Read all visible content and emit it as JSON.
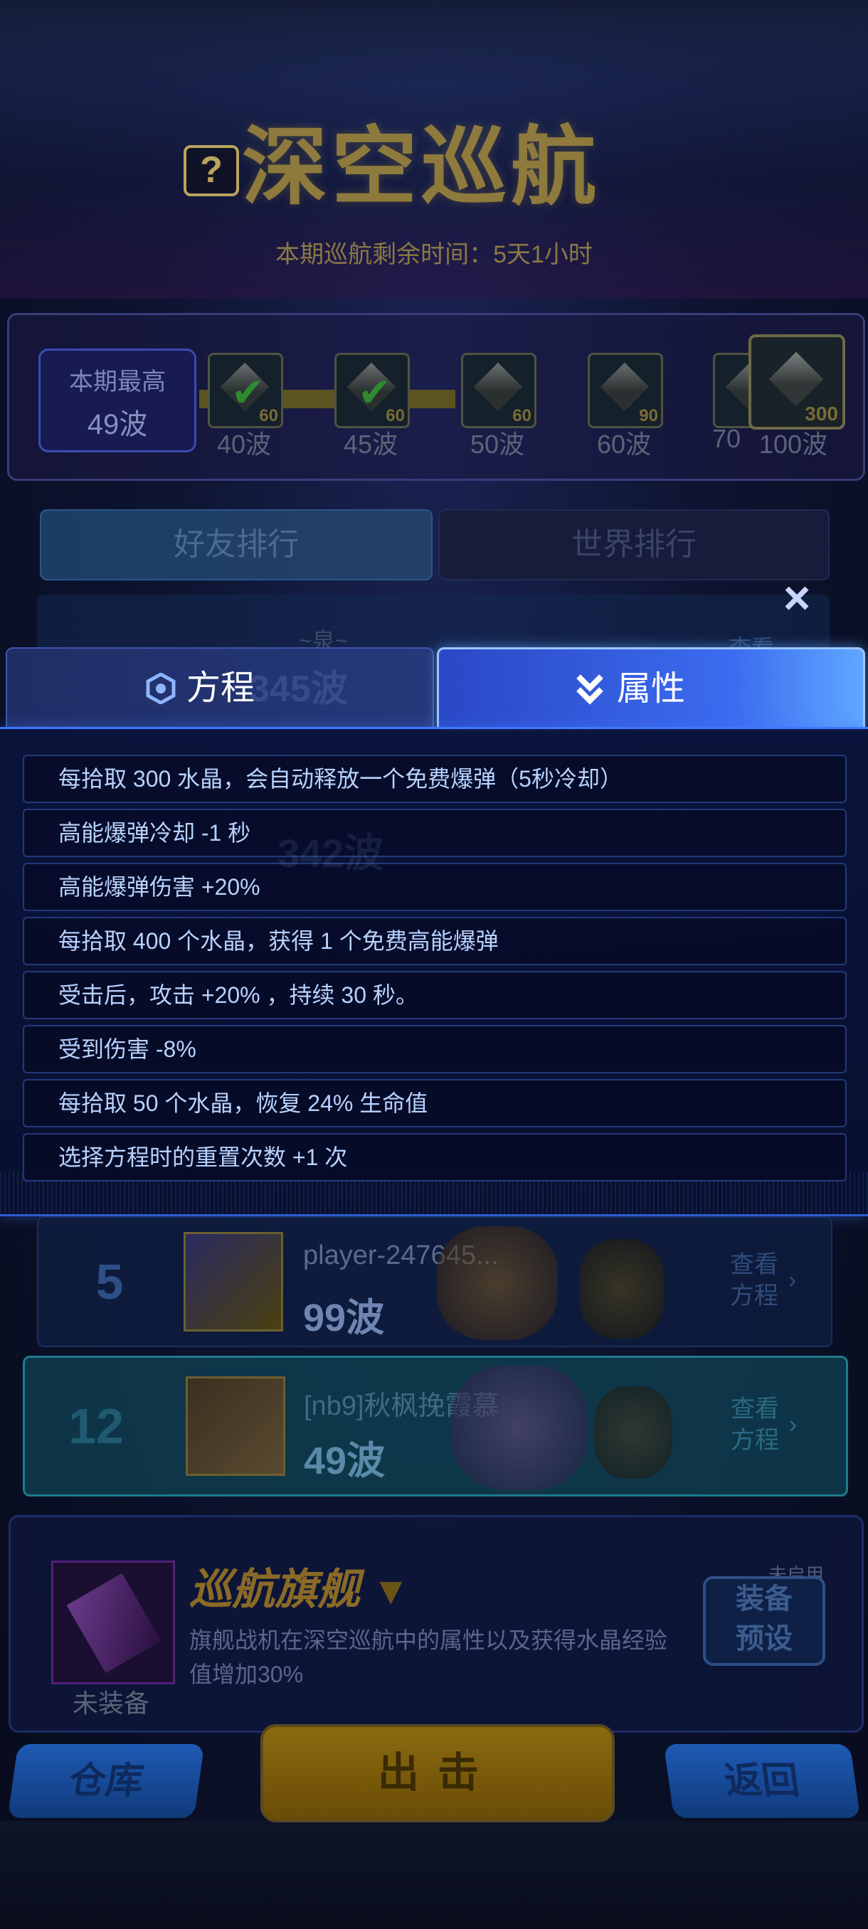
{
  "header": {
    "help_icon": "?",
    "title": "深空巡航",
    "remaining_time": "本期巡航剩余时间：5天1小时"
  },
  "progress": {
    "best_label": "本期最高",
    "best_value": "49波",
    "milestones": [
      {
        "label": "40波",
        "reward": "60",
        "claimed": true
      },
      {
        "label": "45波",
        "reward": "60",
        "claimed": true
      },
      {
        "label": "50波",
        "reward": "60",
        "claimed": false
      },
      {
        "label": "60波",
        "reward": "90",
        "claimed": false
      },
      {
        "label": "70",
        "reward": "",
        "claimed": false
      },
      {
        "label": "100波",
        "reward": "300",
        "claimed": false
      }
    ]
  },
  "tabs": {
    "friends": "好友排行",
    "world": "世界排行"
  },
  "popup": {
    "close_icon": "×",
    "tab_formula": "方程",
    "tab_attributes": "属性",
    "attributes": [
      "每拾取 300 水晶，会自动释放一个免费爆弹（5秒冷却）",
      "高能爆弹冷却 -1 秒",
      "高能爆弹伤害 +20%",
      "每拾取 400 个水晶，获得 1 个免费高能爆弹",
      "受击后，攻击 +20% ，持续 30 秒。",
      "受到伤害 -8%",
      "每拾取 50 个水晶，恢复 24% 生命值",
      "选择方程时的重置次数 +1 次"
    ],
    "behind_text": {
      "name1": "~泉~",
      "waves1": "345波",
      "view1": "查看",
      "waves2": "342波"
    }
  },
  "ranking": [
    {
      "rank": "5",
      "name": "player-247645...",
      "waves": "99波",
      "view": "查看",
      "view2": "方程",
      "me": false
    },
    {
      "rank": "12",
      "name": "[nb9]秋枫挽霞慕",
      "waves": "49波",
      "view": "查看",
      "view2": "方程",
      "me": true
    }
  ],
  "flagship": {
    "title": "巡航旗舰",
    "desc": "旗舰战机在深空巡航中的属性以及获得水晶经验值增加30%",
    "unequipped": "未装备",
    "equip_btn_line1": "装备",
    "equip_btn_line2": "预设",
    "not_enabled": "未启用"
  },
  "buttons": {
    "warehouse": "仓库",
    "attack": "出击",
    "back": "返回"
  },
  "colors": {
    "accent": "#3c6cf0",
    "attribute_text": "#b8d2ff",
    "gold": "#8a6a26"
  }
}
